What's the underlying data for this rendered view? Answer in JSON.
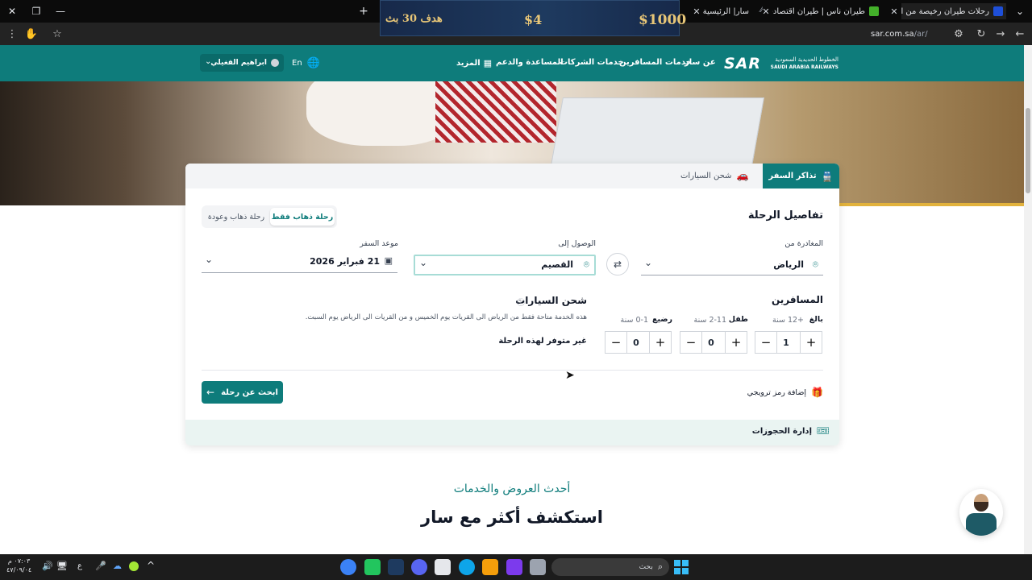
{
  "browser": {
    "tabs": [
      {
        "title": "رحلات طيران رخيصة من الرياض"
      },
      {
        "title": "طيران ناس | طيران اقتصادي سعو"
      },
      {
        "title": "سار| الرئيسية"
      }
    ],
    "url_host": "sar.com.sa",
    "url_path": "/ar/"
  },
  "ad": {
    "price1": "$1000",
    "price2": "$4",
    "label": "هدف 30 بث"
  },
  "site": {
    "logo_ar": "الخطوط الحديدية السعودية",
    "logo_en": "SAUDI ARABIA RAILWAYS",
    "logo_mark": "SAR",
    "nav": [
      "عن سار",
      "خدمات المسافرين",
      "خدمات الشركات",
      "المساعدة والدعم",
      "المزيد"
    ],
    "lang": "En",
    "user": "ابراهيم الفغيلي"
  },
  "booking": {
    "tabs": [
      "تذاكر السفر",
      "شحن السيارات"
    ],
    "title": "تفاصيل الرحلة",
    "trip_types": [
      "رحلة ذهاب فقط",
      "رحلة ذهاب وعودة"
    ],
    "from_label": "المغادرة من",
    "from_value": "الرياض",
    "to_label": "الوصول إلى",
    "to_value": "القصيم",
    "date_label": "موعد السفر",
    "date_value": "21 فبراير 2026",
    "passengers_title": "المسافرين",
    "passenger_types": [
      {
        "label": "بالغ",
        "age": "+12 سنة",
        "count": "1"
      },
      {
        "label": "طفل",
        "age": "2-11 سنة",
        "count": "0"
      },
      {
        "label": "رضيع",
        "age": "0-1 سنة",
        "count": "0"
      }
    ],
    "car_title": "شحن السيارات",
    "car_note": "هذه الخدمة متاحة فقط من الرياض الى القريات يوم الخميس و من القريات الى الرياض يوم السبت.",
    "car_unavailable": "غير متوفر لهذه الرحلة",
    "promo": "إضافة رمز ترويجي",
    "search_button": "ابحث عن رحلة",
    "manage_bookings": "إدارة الحجوزات"
  },
  "offers": {
    "subtitle": "أحدث العروض والخدمات",
    "title": "استكشف أكثر مع سار"
  },
  "taskbar": {
    "search": "بحث",
    "time": "٠٧:٠٣ م",
    "date": "٤٧/٠٩/٠٤",
    "lang": "ع"
  },
  "colors": {
    "brand": "#0e7c7b",
    "accent_gold": "#e2b23c"
  }
}
